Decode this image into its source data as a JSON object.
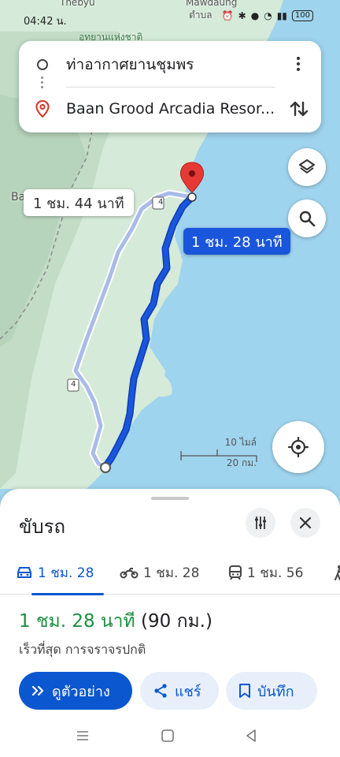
{
  "status_bar": {
    "time": "04:42 น.",
    "battery": "100"
  },
  "map_labels": {
    "top_left_fragment": "Thebyu",
    "top_center": "อุทยานแห่งชาติ",
    "top_right": "Mawdaung",
    "top_right_sub": "ตําบล",
    "left_edge": "Ba",
    "highway_1": "4",
    "highway_2": "4"
  },
  "route_card": {
    "origin": "ท่าอากาศยานชุมพร",
    "destination": "Baan Grood Arcadia Resor...",
    "more_icon": "more-vert-icon",
    "swap_icon": "swap-vert-icon"
  },
  "map_controls": {
    "layers_icon": "layers-icon",
    "search_icon": "search-icon",
    "location_icon": "my-location-icon"
  },
  "route_bubbles": {
    "alternate": "1 ชม. 44 นาที",
    "selected": "1 ชม. 28 นาที"
  },
  "scale": {
    "top": "10 ไมล์",
    "bottom": "20 กม."
  },
  "sheet": {
    "title": "ขับรถ",
    "options_icon": "tune-icon",
    "close_icon": "close-icon",
    "modes": [
      {
        "icon": "car-icon",
        "label": "1 ชม. 28",
        "active": true
      },
      {
        "icon": "motorcycle-icon",
        "label": "1 ชม. 28",
        "active": false
      },
      {
        "icon": "transit-icon",
        "label": "1 ชม. 56",
        "active": false
      },
      {
        "icon": "walk-icon",
        "label": "",
        "active": false
      }
    ],
    "result_time": "1 ชม. 28 นาที",
    "result_distance": "(90 กม.)",
    "result_note": "เร็วที่สุด การจราจรปกติ",
    "buttons": {
      "preview": "ดูตัวอย่าง",
      "share": "แชร์",
      "save": "บันทึก"
    }
  },
  "colors": {
    "route_main": "#1a56db",
    "route_alt": "#a9bbe8",
    "land": "#d6ead8",
    "sea": "#9bd3ef",
    "accent": "#0b57d0",
    "green_time": "#1e8e3e"
  }
}
